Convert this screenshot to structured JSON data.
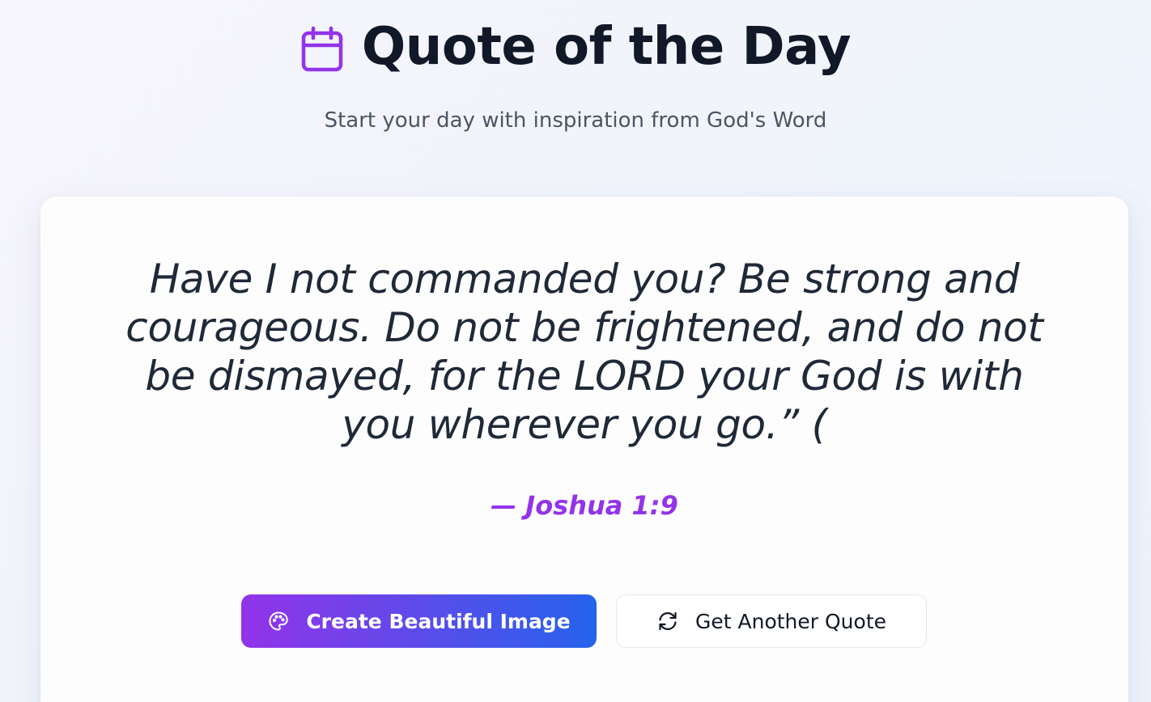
{
  "header": {
    "title": "Quote of the Day",
    "title_icon": "calendar-icon",
    "subtitle": "Start your day with inspiration from God's Word"
  },
  "quote": {
    "text": "Have I not commanded you? Be strong and courageous. Do not be frightened, and do not be dismayed, for the LORD your God is with you wherever you go.” (",
    "reference": "— Joshua 1:9"
  },
  "actions": {
    "create_image_label": "Create Beautiful Image",
    "create_image_icon": "palette-icon",
    "another_quote_label": "Get Another Quote",
    "another_quote_icon": "refresh-icon"
  },
  "colors": {
    "accent": "#9333ea",
    "gradient_start": "#9333ea",
    "gradient_end": "#2563eb",
    "title_text": "#111827"
  }
}
